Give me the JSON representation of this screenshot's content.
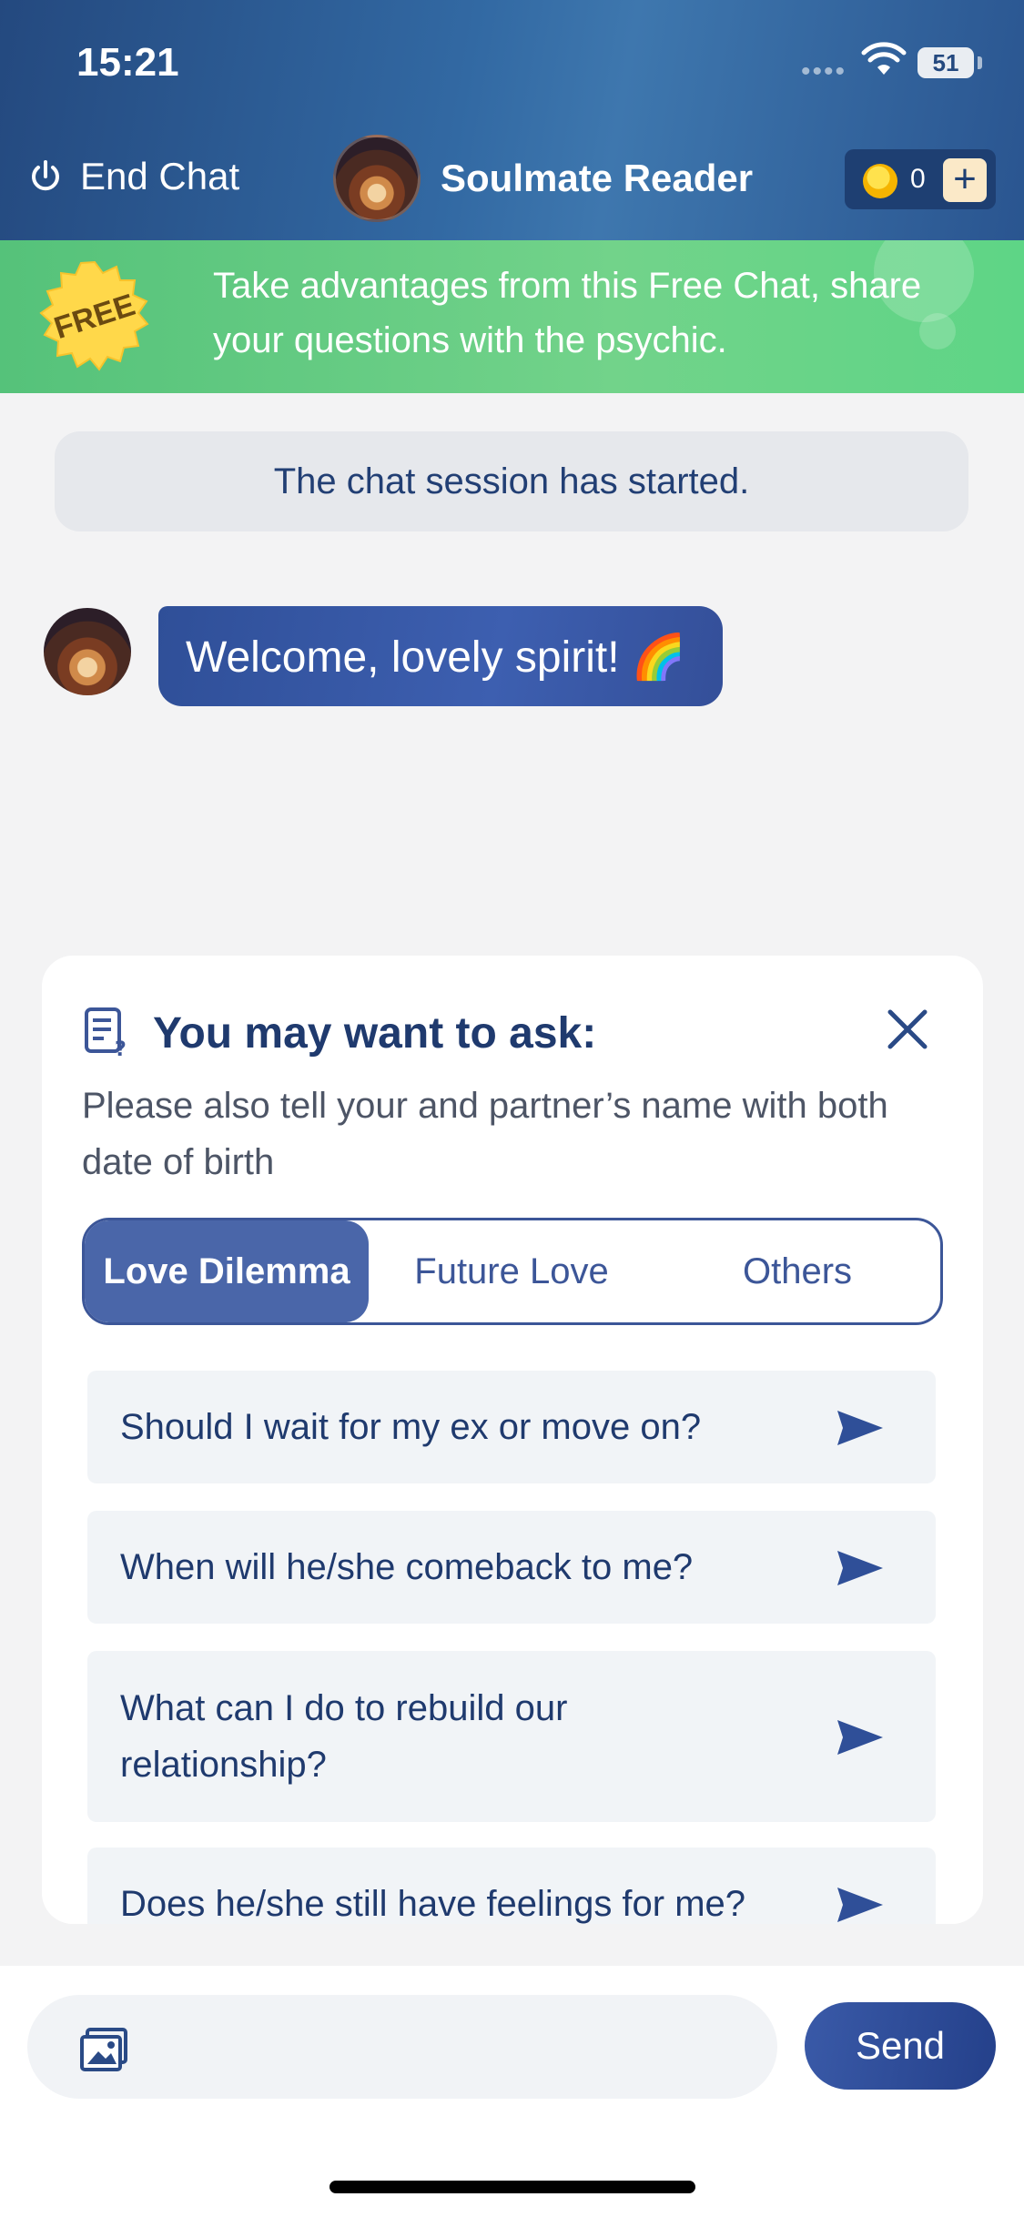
{
  "status_bar": {
    "time": "15:21",
    "battery": "51"
  },
  "header": {
    "end_chat_label": "End Chat",
    "reader_name": "Soulmate Reader",
    "coin_count": "0",
    "add_label": "+"
  },
  "promo": {
    "badge": "FREE",
    "text": "Take advantages from this Free Chat, share your questions with the psychic."
  },
  "chat": {
    "session_notice": "The chat session has started.",
    "messages": [
      {
        "from": "reader",
        "text": "Welcome, lovely spirit! 🌈"
      }
    ]
  },
  "suggestions": {
    "title": "You may want to ask:",
    "subtitle": "Please also tell your and partner’s name with both date of birth",
    "tabs": [
      {
        "label": "Love Dilemma",
        "active": true
      },
      {
        "label": "Future Love",
        "active": false
      },
      {
        "label": "Others",
        "active": false
      }
    ],
    "questions": [
      "Should I wait for my ex or move on?",
      "When will he/she comeback to me?",
      "What can I do to rebuild our relationship?",
      "Does he/she still have feelings for me?"
    ]
  },
  "composer": {
    "send_label": "Send"
  },
  "colors": {
    "header": "#2f5f9a",
    "promo_green": "#66cc84",
    "accent_blue": "#3c5698",
    "bubble_blue": "#3553a3"
  },
  "icons": [
    "power-icon",
    "coin-icon",
    "plus-icon",
    "question-list-icon",
    "close-icon",
    "send-arrow-icon",
    "image-icon",
    "wifi-icon"
  ]
}
